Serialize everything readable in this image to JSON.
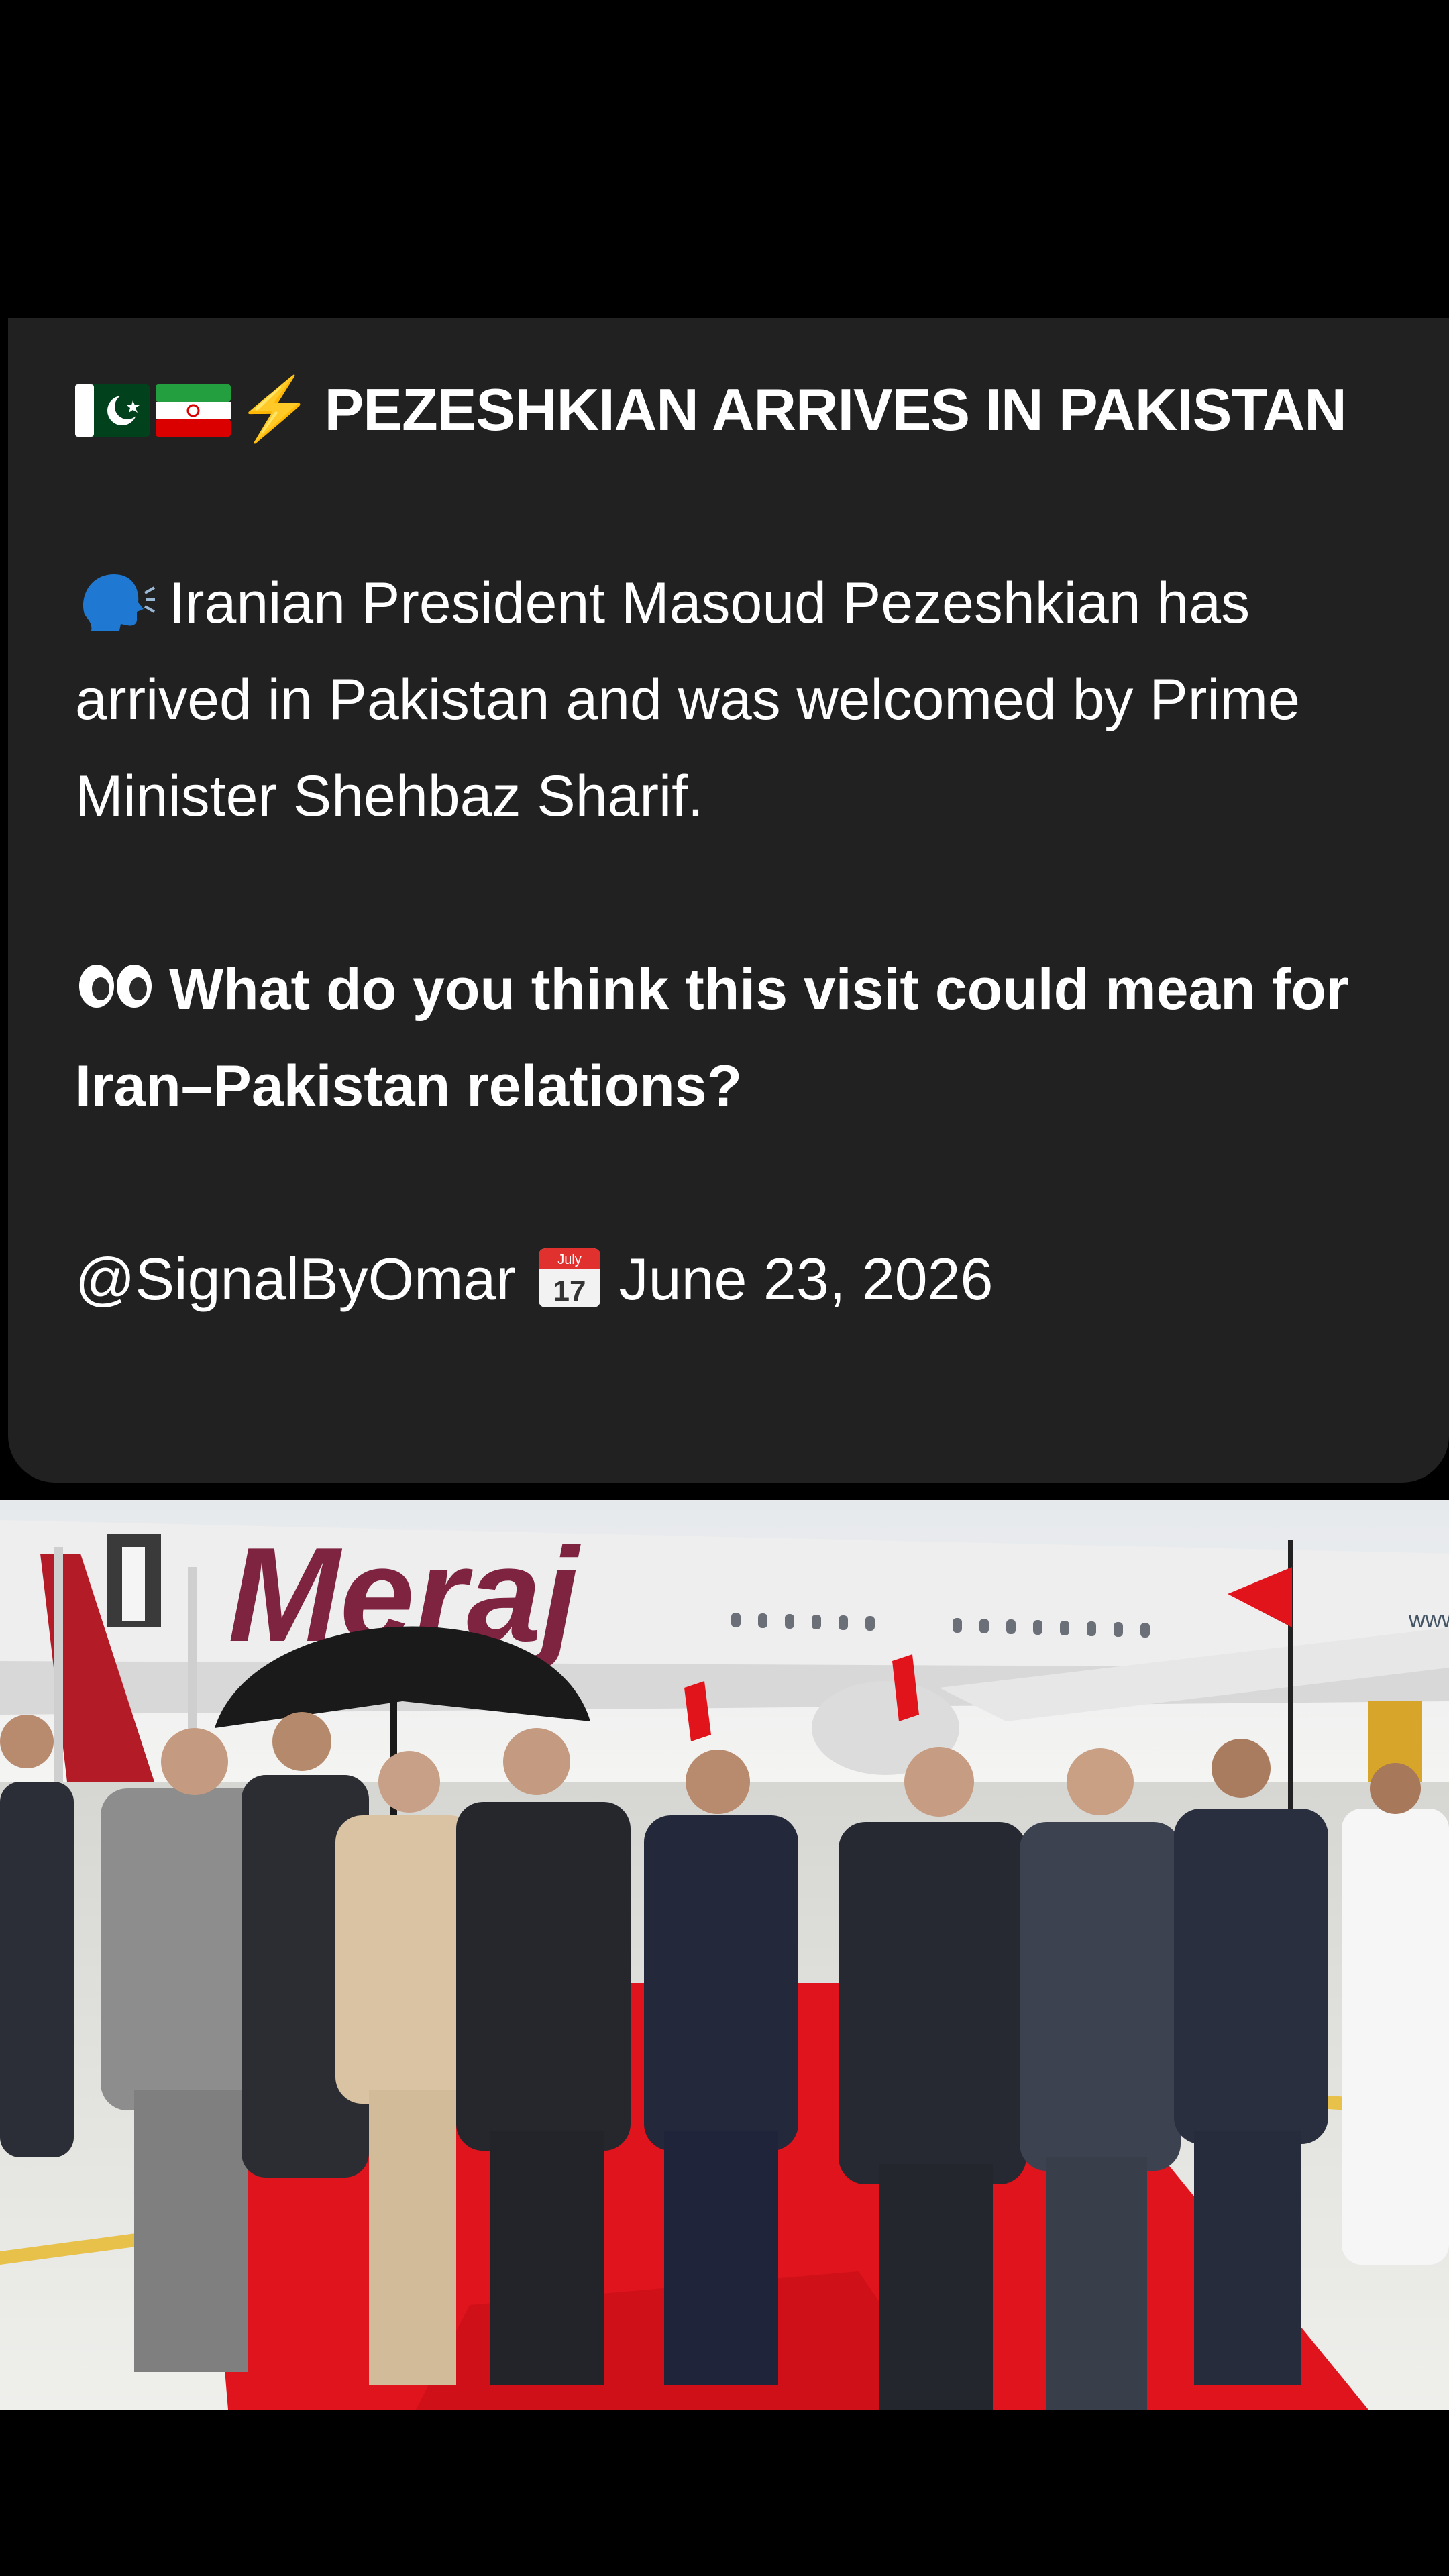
{
  "post": {
    "headline": "PEZESHKIAN ARRIVES IN PAKISTAN",
    "body": "Iranian President Masoud Pezeshkian has arrived in Pakistan and was welcomed by Prime Minister Shehbaz Sharif.",
    "question": "What do you think this visit could mean for Iran–Pakistan relations?",
    "handle": "@SignalByOmar",
    "date": "June 23, 2026",
    "calendar_month": "July",
    "calendar_day": "17",
    "icons": [
      "pakistan-flag-icon",
      "iran-flag-icon",
      "lightning-icon",
      "speaking-head-icon",
      "eyes-icon",
      "calendar-icon"
    ]
  },
  "photo": {
    "aircraft_livery": "Meraj",
    "aircraft_url_fragment": "www"
  },
  "colors": {
    "background": "#000000",
    "card": "#212121",
    "text": "#ffffff",
    "red_carpet": "#e0141c"
  }
}
